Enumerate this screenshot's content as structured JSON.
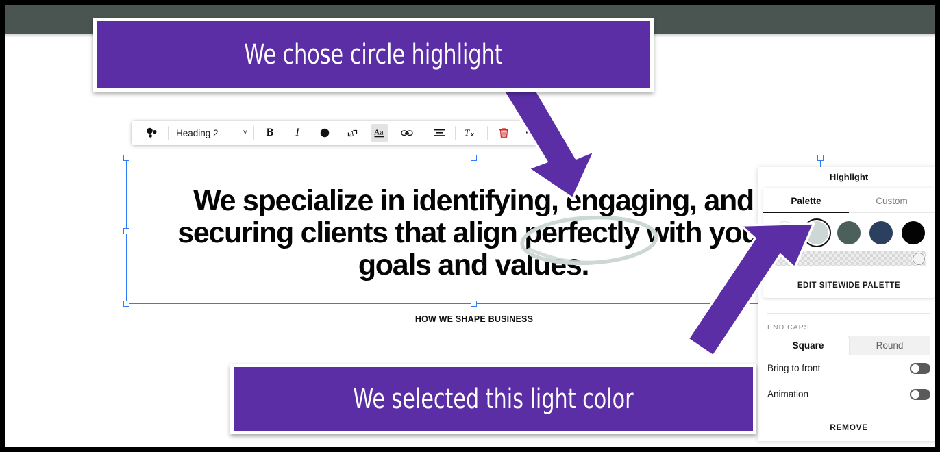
{
  "window": {
    "top_bar_color": "#4a5551",
    "frame_color": "#000000"
  },
  "toolbar": {
    "block_type_icon": "paragraph-style-icon",
    "block_type_value": "Heading 2",
    "chevron": "˅",
    "bold_label": "B",
    "italic_label": "I",
    "color_label": "●",
    "text_effect_label": "A",
    "highlight_label": "Aa",
    "link_label": "link-icon",
    "align_label": "align-icon",
    "clear_format_label": "Tx",
    "delete_label": "trash-icon",
    "more_label": "⋯"
  },
  "canvas": {
    "eyebrow": "HOW WE SHAPE BUSINESS",
    "heading": "We specialize in identifying, engaging, and\nsecuring clients that align perfectly with your\ngoals and values.",
    "highlighted_word": "perfectly",
    "highlight_shape": "circle",
    "highlight_color": "#cdd7d5"
  },
  "panel": {
    "title": "Highlight",
    "tabs": [
      {
        "label": "Palette",
        "active": true
      },
      {
        "label": "Custom",
        "active": false
      }
    ],
    "swatches": [
      {
        "name": "white",
        "color": "#ffffff",
        "selected": false
      },
      {
        "name": "light-gray-blue",
        "color": "#ccd7d6",
        "selected": true
      },
      {
        "name": "sage-green",
        "color": "#4c605b",
        "selected": false
      },
      {
        "name": "navy-blue",
        "color": "#2b3f5e",
        "selected": false
      },
      {
        "name": "black",
        "color": "#030303",
        "selected": false
      }
    ],
    "opacity_label": "opacity-slider",
    "edit_palette_label": "EDIT SITEWIDE PALETTE",
    "end_caps_label": "END CAPS",
    "end_caps": [
      {
        "label": "Square",
        "active": true
      },
      {
        "label": "Round",
        "active": false
      }
    ],
    "toggles": [
      {
        "label": "Bring to front",
        "on": false
      },
      {
        "label": "Animation",
        "on": false
      }
    ],
    "remove_label": "REMOVE"
  },
  "annotations": {
    "color": "#5b2ea6",
    "callouts": [
      {
        "text": "We chose circle highlight"
      },
      {
        "text": "We selected this light color"
      }
    ]
  }
}
